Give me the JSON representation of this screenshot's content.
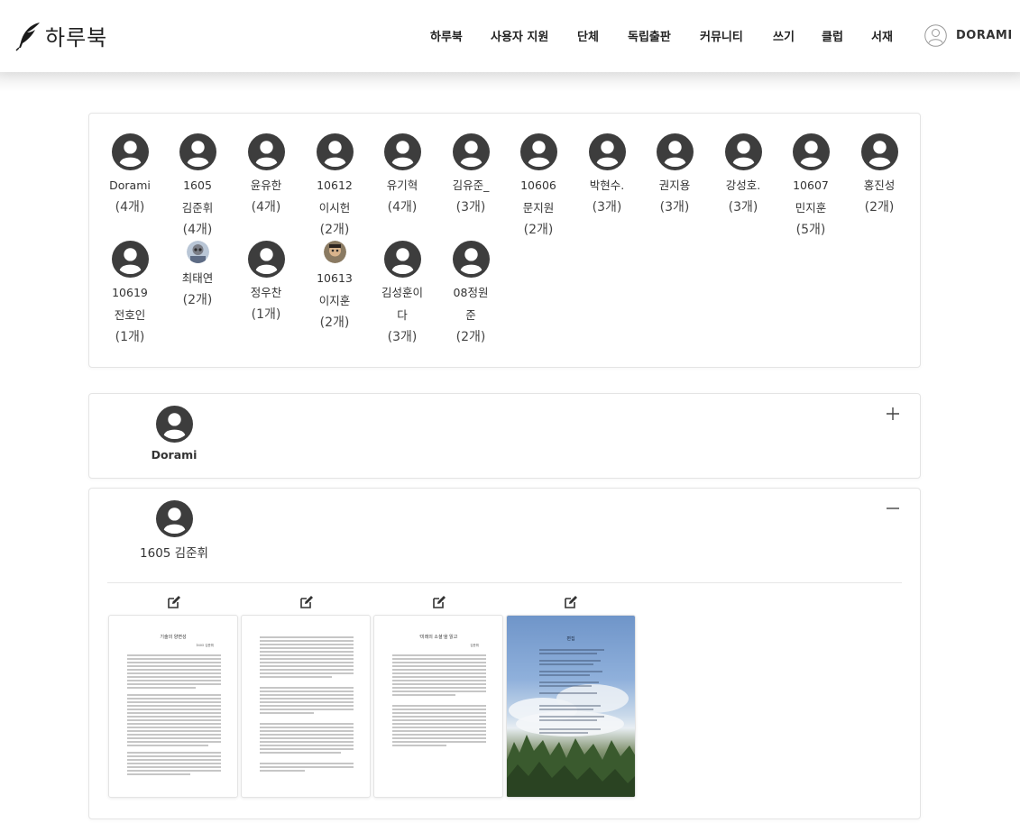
{
  "header": {
    "logo_text": "하루북",
    "nav": [
      "하루북",
      "사용자 지원",
      "단체",
      "독립출판",
      "커뮤니티",
      "쓰기",
      "클럽",
      "서재"
    ],
    "user_name": "DORAMI"
  },
  "authors": [
    {
      "name": "Dorami",
      "count": "(4개)",
      "avatar": "default"
    },
    {
      "name": "1605 김준휘",
      "count": "(4개)",
      "avatar": "default"
    },
    {
      "name": "윤유한",
      "count": "(4개)",
      "avatar": "default"
    },
    {
      "name": "10612 이시헌",
      "count": "(2개)",
      "avatar": "default"
    },
    {
      "name": "유기혁",
      "count": "(4개)",
      "avatar": "default"
    },
    {
      "name": "김유준_",
      "count": "(3개)",
      "avatar": "default"
    },
    {
      "name": "10606 문지원",
      "count": "(2개)",
      "avatar": "default"
    },
    {
      "name": "박현수.",
      "count": "(3개)",
      "avatar": "default"
    },
    {
      "name": "권지용",
      "count": "(3개)",
      "avatar": "default"
    },
    {
      "name": "강성호.",
      "count": "(3개)",
      "avatar": "default"
    },
    {
      "name": "10607 민지훈",
      "count": "(5개)",
      "avatar": "default"
    },
    {
      "name": "홍진성",
      "count": "(2개)",
      "avatar": "default"
    },
    {
      "name": "10619전호인",
      "count": "(1개)",
      "avatar": "default"
    },
    {
      "name": "최태연",
      "count": "(2개)",
      "avatar": "photo"
    },
    {
      "name": "정우찬",
      "count": "(1개)",
      "avatar": "default"
    },
    {
      "name": "10613이지훈",
      "count": "(2개)",
      "avatar": "photo"
    },
    {
      "name": "김성훈이다",
      "count": "(3개)",
      "avatar": "default"
    },
    {
      "name": "08정원준",
      "count": "(2개)",
      "avatar": "default"
    }
  ],
  "groups": [
    {
      "name": "Dorami",
      "expanded": false,
      "toggle": "plus"
    },
    {
      "name": "1605 김준휘",
      "expanded": true,
      "toggle": "minus"
    }
  ],
  "books": [
    {
      "title": "기술의 양면성",
      "subtitle": "1605 김준휘",
      "type": "text"
    },
    {
      "title": "",
      "subtitle": "",
      "type": "text"
    },
    {
      "title": "'미래의 소셜'을 읽고",
      "subtitle": "김준휘",
      "type": "text"
    },
    {
      "title": "편집",
      "subtitle": "김준휘",
      "type": "photo"
    }
  ],
  "colors": {
    "avatar": "#3d3d3d",
    "border": "#e4e4e4",
    "accent": "#333333"
  }
}
